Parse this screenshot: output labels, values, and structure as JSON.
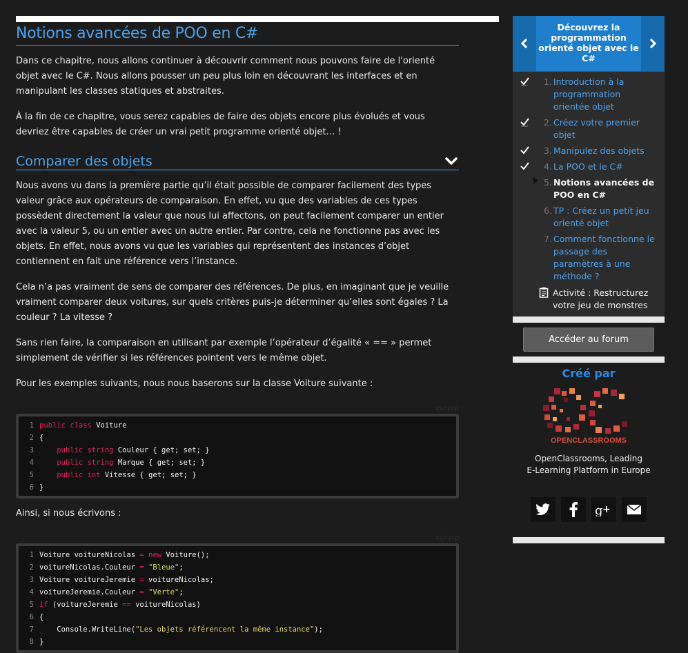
{
  "main": {
    "title": "Notions avancées de POO en C#",
    "intro": [
      "Dans ce chapitre, nous allons continuer à découvrir comment nous pouvons faire de l'orienté objet avec le C#. Nous allons pousser un peu plus loin en découvrant les interfaces et en manipulant les classes statiques et abstraites.",
      "À la fin de ce chapitre, vous serez capables de faire des objets encore plus évolués et vous devriez être capables de créer un vrai petit programme orienté objet… !"
    ],
    "section_title": "Comparer des objets",
    "section_paragraphs": [
      "Nous avons vu dans la première partie qu’il était possible de comparer facilement des types valeur grâce aux opérateurs de comparaison. En effet, vu que des variables de ces types possèdent directement la valeur que nous lui affectons, on peut facilement comparer un entier avec la valeur 5, ou un entier avec un autre entier. Par contre, cela ne fonctionne pas avec les objets. En effet, nous avons vu que les variables qui représentent des instances d’objet contiennent en fait une référence vers l’instance.",
      "Cela n’a pas vraiment de sens de comparer des références. De plus, en imaginant que je veuille vraiment comparer deux voitures, sur quels critères puis-je déterminer qu’elles sont égales ? La couleur ? La vitesse ?",
      "Sans rien faire, la comparaison en utilisant par exemple l’opérateur d’égalité « == » permet simplement de vérifier si les références pointent vers le même objet.",
      "Pour les exemples suivants, nous nous baserons sur la classe Voiture suivante :"
    ],
    "code_lang": "csharp",
    "ainsi": "Ainsi, si nous écrivons :"
  },
  "sidebar": {
    "prev_icon": "chevron-left-icon",
    "next_icon": "chevron-right-icon",
    "course_title": "Découvrez la programmation orienté objet avec le C#",
    "toc": [
      {
        "num": "1.",
        "label": "Introduction à la programmation orientée objet",
        "state": "done"
      },
      {
        "num": "2.",
        "label": "Créez votre premier objet",
        "state": "done"
      },
      {
        "num": "3.",
        "label": "Manipulez des objets",
        "state": "done"
      },
      {
        "num": "4.",
        "label": "La POO et le C#",
        "state": "done"
      },
      {
        "num": "5.",
        "label": "Notions avancées de POO en C#",
        "state": "current"
      },
      {
        "num": "6.",
        "label": "TP : Créez un petit jeu orienté objet",
        "state": "todo"
      },
      {
        "num": "7.",
        "label": "Comment fonctionne le passage des paramètres à une méthode ?",
        "state": "todo"
      }
    ],
    "activity_label": "Activité : Restructurez votre jeu de monstres",
    "forum_button": "Accéder au forum",
    "created_by": "Créé par",
    "logo_text": "OPENCLASSROOMS",
    "tagline_line1": "OpenClassrooms, Leading",
    "tagline_line2": "E-Learning Platform in Europe",
    "social": [
      "twitter-icon",
      "facebook-icon",
      "google-plus-icon",
      "email-icon"
    ]
  },
  "colors": {
    "accent": "#4ba3ee",
    "background": "#1c1c1c",
    "keyword": "#e0235b",
    "string": "#e2d36a"
  }
}
